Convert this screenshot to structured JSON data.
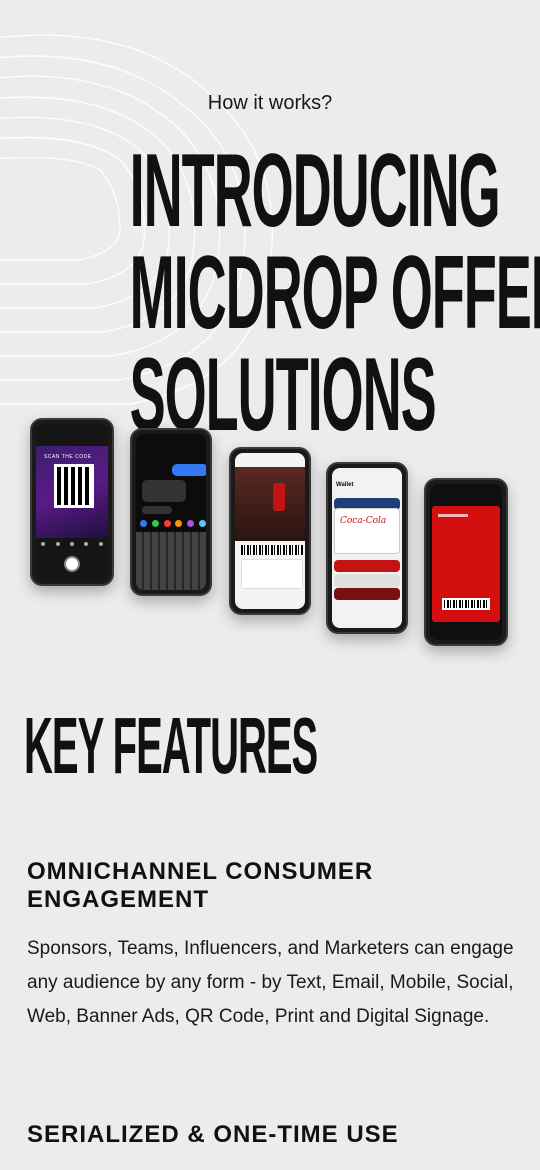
{
  "hero": {
    "eyebrow": "How it works?",
    "title_lines": [
      "INTRODUCING",
      "MICDROP OFFER",
      "SOLUTIONS"
    ]
  },
  "phones": [
    {
      "label": "SCAN THE CODE",
      "icon": "qr-camera-screen"
    },
    {
      "icon": "text-message-screen"
    },
    {
      "icon": "offer-landing-screen"
    },
    {
      "label": "Wallet",
      "brand": "Coca-Cola",
      "icon": "wallet-pass-screen"
    },
    {
      "icon": "coupon-barcode-screen"
    }
  ],
  "key_features": {
    "title": "KEY FEATURES",
    "items": [
      {
        "heading": "OMNICHANNEL CONSUMER ENGAGEMENT",
        "body": "Sponsors, Teams, Influencers, and Marketers can engage any audience by any form - by Text, Email, Mobile, Social, Web, Banner Ads, QR Code, Print and Digital Signage."
      },
      {
        "heading": "SERIALIZED & ONE-TIME USE"
      }
    ]
  },
  "colors": {
    "background": "#ececec",
    "brand_red": "#d40f0f",
    "text": "#111111"
  }
}
